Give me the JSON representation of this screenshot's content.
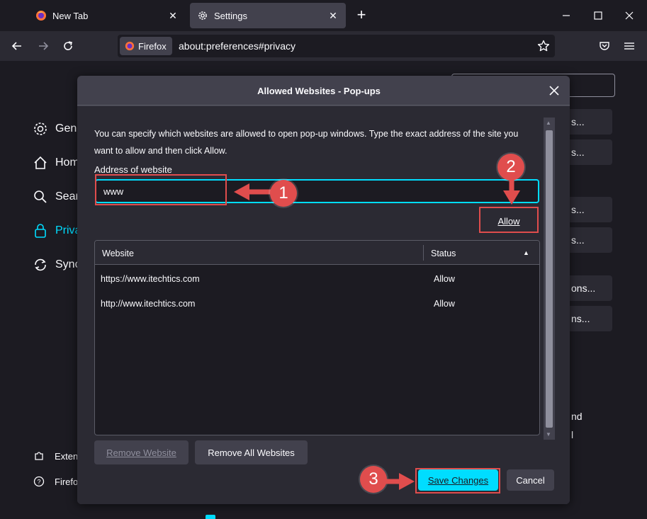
{
  "tabs": [
    {
      "label": "New Tab",
      "icon": "firefox-icon",
      "active": false
    },
    {
      "label": "Settings",
      "icon": "gear-icon",
      "active": true
    }
  ],
  "window_controls": {
    "new_tab": "+",
    "minimize": "minimize-icon",
    "maximize": "maximize-icon",
    "close": "close-icon"
  },
  "navbar": {
    "identity_label": "Firefox",
    "url": "about:preferences#privacy"
  },
  "background": {
    "sidebar": [
      {
        "label": "Gene",
        "icon": "gear-icon"
      },
      {
        "label": "Hom",
        "icon": "home-icon"
      },
      {
        "label": "Sear",
        "icon": "search-icon"
      },
      {
        "label": "Priva",
        "icon": "lock-icon"
      },
      {
        "label": "Sync",
        "icon": "sync-icon"
      }
    ],
    "sidebar_bottom": [
      {
        "label": "Exten",
        "icon": "puzzle-icon"
      },
      {
        "label": "Firefo",
        "icon": "help-icon"
      }
    ],
    "right_buttons": [
      "s...",
      "s...",
      "s...",
      "s...",
      "ons...",
      "ns..."
    ],
    "right_text": [
      "nd",
      "l"
    ]
  },
  "dialog": {
    "title": "Allowed Websites - Pop-ups",
    "description": "You can specify which websites are allowed to open pop-up windows. Type the exact address of the site you want to allow and then click Allow.",
    "address_label": "Address of website",
    "address_value": "www",
    "allow_label": "Allow",
    "columns": {
      "website": "Website",
      "status": "Status"
    },
    "rows": [
      {
        "website": "https://www.itechtics.com",
        "status": "Allow"
      },
      {
        "website": "http://www.itechtics.com",
        "status": "Allow"
      }
    ],
    "remove_label": "Remove Website",
    "remove_all_label": "Remove All Websites",
    "save_label": "Save Changes",
    "cancel_label": "Cancel"
  },
  "annotations": {
    "step1": "1",
    "step2": "2",
    "step3": "3",
    "color": "#e04d4d"
  },
  "colors": {
    "accent": "#00ddff",
    "dialog_bg": "#2b2a33",
    "page_bg": "#1c1b22"
  }
}
